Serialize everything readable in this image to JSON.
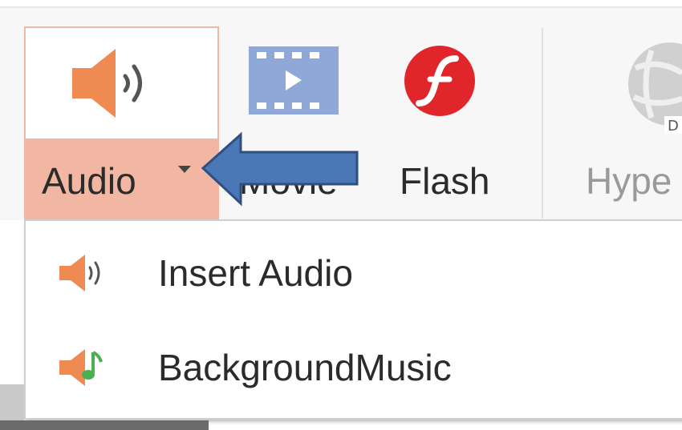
{
  "ribbon": {
    "audio": {
      "label": "Audio"
    },
    "movie": {
      "label": "Movie"
    },
    "flash": {
      "label": "Flash"
    },
    "hyperlink": {
      "label": "Hype"
    }
  },
  "menu": {
    "items": [
      {
        "label": "Insert Audio",
        "icon": "speaker-icon"
      },
      {
        "label": "BackgroundMusic",
        "icon": "speaker-music-note-icon"
      }
    ]
  },
  "colors": {
    "accent_hover": "#f1b7a3",
    "speaker_orange": "#ef8a52",
    "movie_blue": "#8fa8d8",
    "flash_red": "#e0262b",
    "arrow_blue": "#4a77b5",
    "music_green": "#4caf50"
  }
}
